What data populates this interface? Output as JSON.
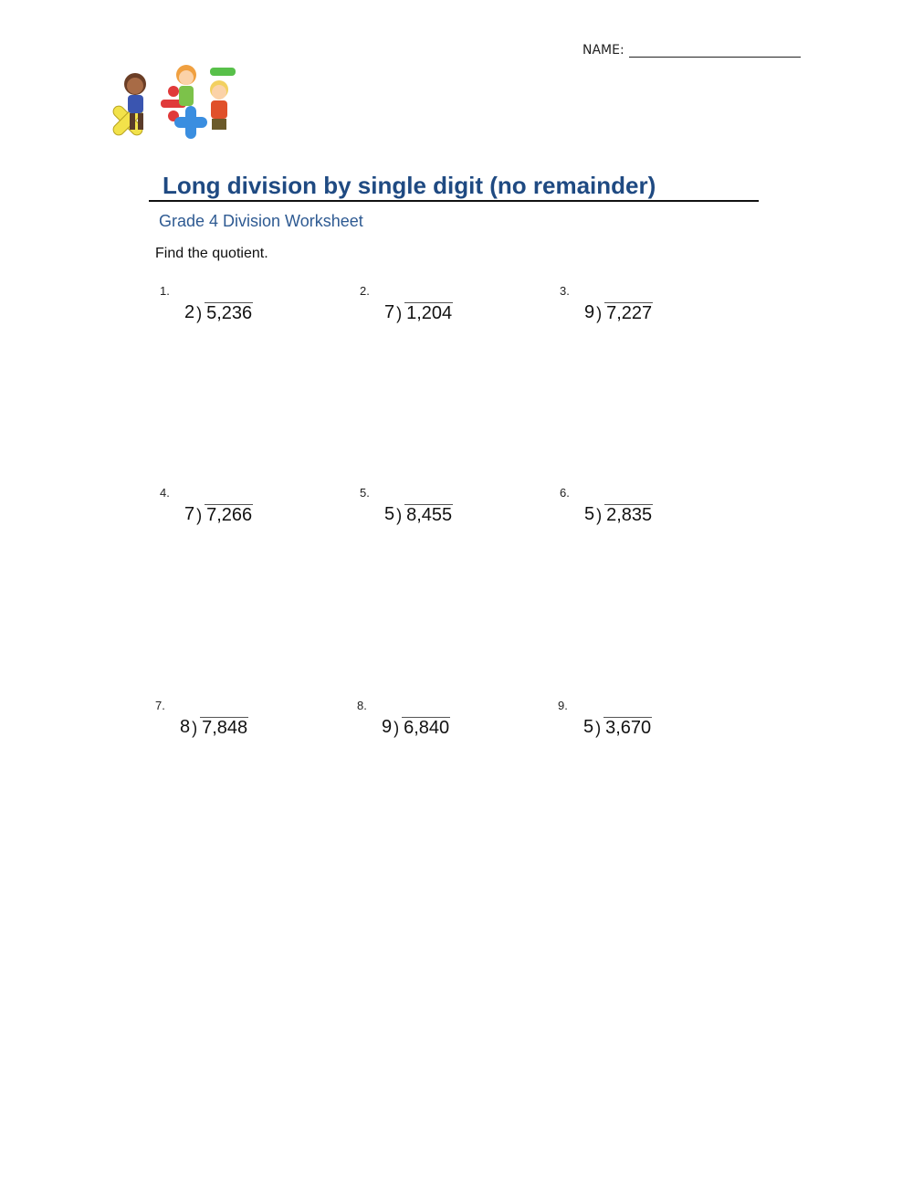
{
  "header": {
    "name_label": "NAME:"
  },
  "clipart": {
    "icon": "kids-math-symbols-clipart"
  },
  "title": "Long division by single digit (no remainder)",
  "subtitle": "Grade 4 Division Worksheet",
  "instructions": "Find the quotient.",
  "problems": [
    {
      "number": "1.",
      "divisor": "2",
      "dividend": "5,236"
    },
    {
      "number": "2.",
      "divisor": "7",
      "dividend": "1,204"
    },
    {
      "number": "3.",
      "divisor": "9",
      "dividend": "7,227"
    },
    {
      "number": "4.",
      "divisor": "7",
      "dividend": "7,266"
    },
    {
      "number": "5.",
      "divisor": "5",
      "dividend": "8,455"
    },
    {
      "number": "6.",
      "divisor": "5",
      "dividend": "2,835"
    },
    {
      "number": "7.",
      "divisor": "8",
      "dividend": "7,848"
    },
    {
      "number": "8.",
      "divisor": "9",
      "dividend": "6,840"
    },
    {
      "number": "9.",
      "divisor": "5",
      "dividend": "3,670"
    }
  ],
  "bracket_glyph": ")"
}
